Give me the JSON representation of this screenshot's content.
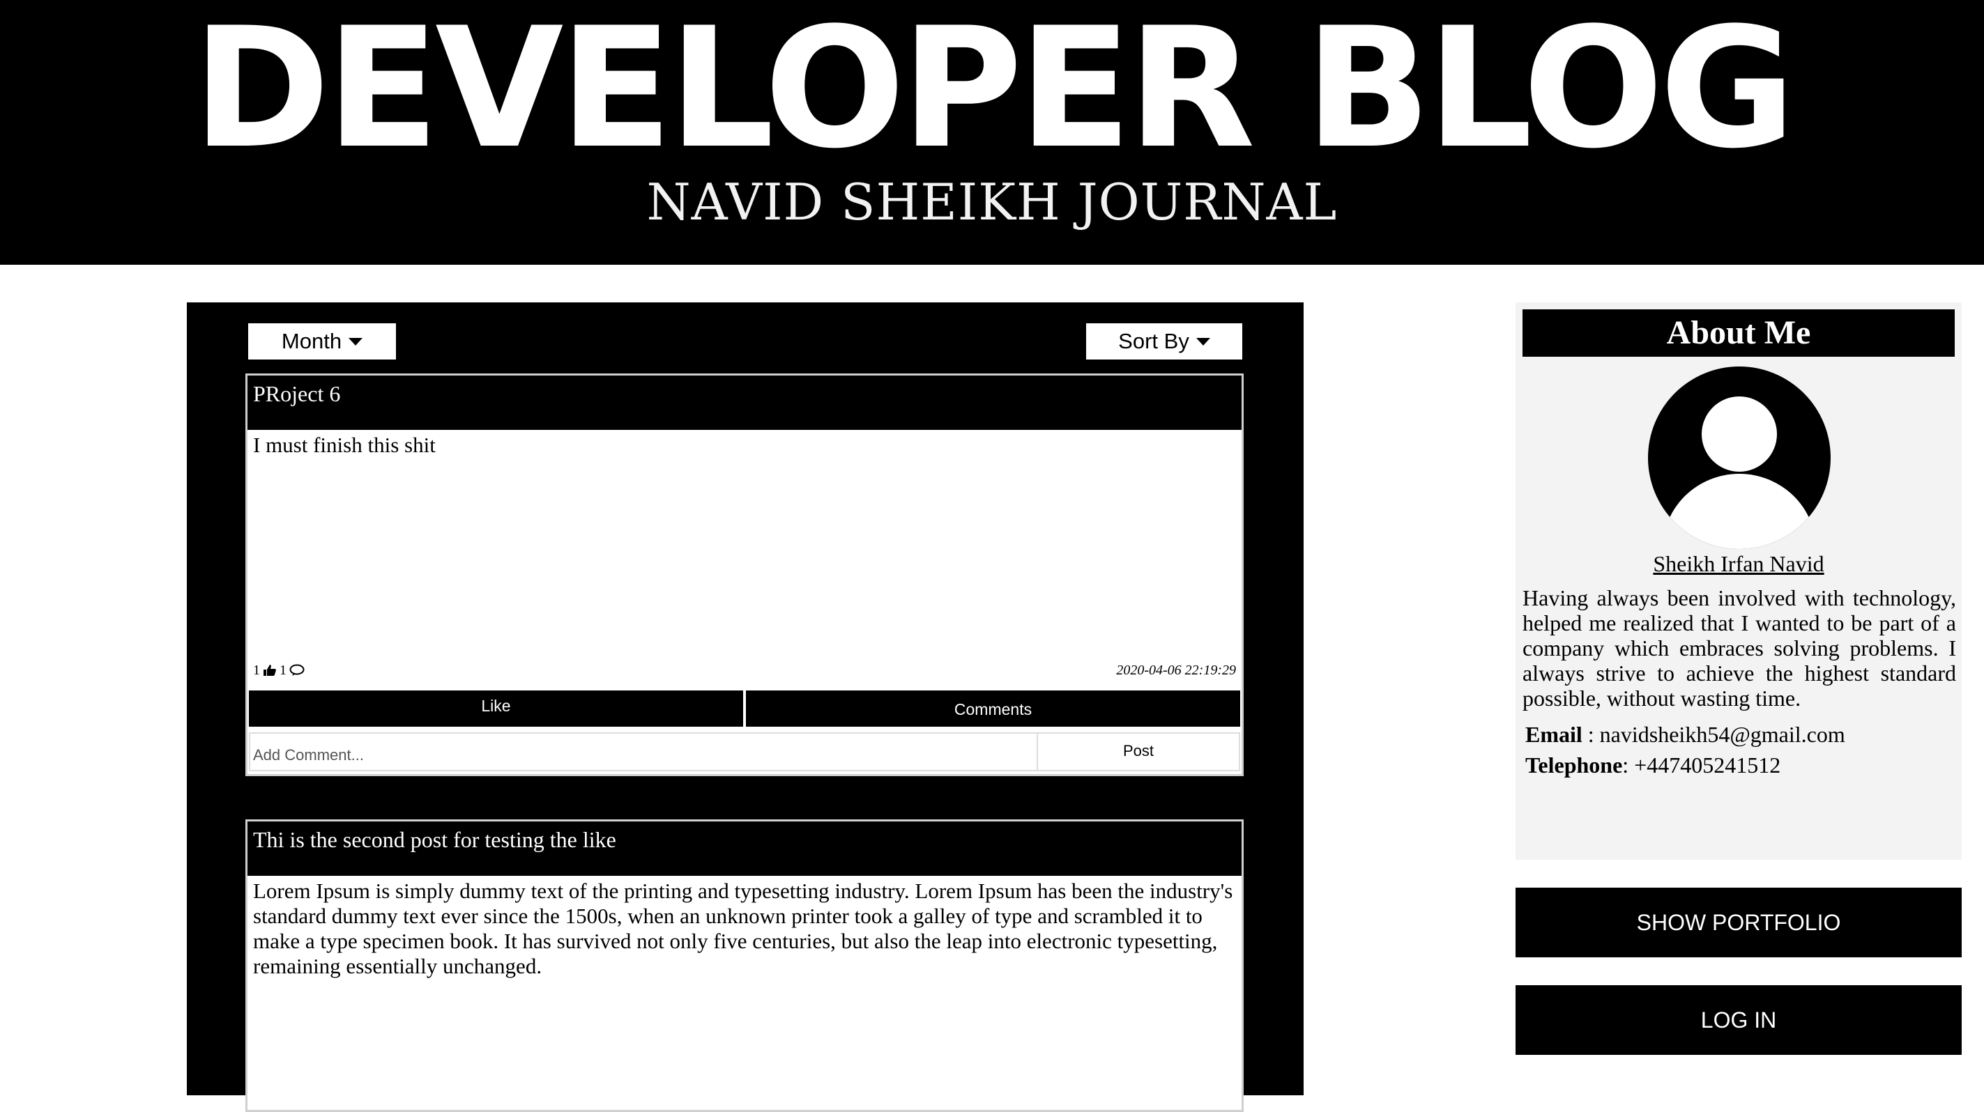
{
  "header": {
    "title": "DEVELOPER BLOG",
    "subtitle": "NAVID SHEIKH JOURNAL"
  },
  "filters": {
    "month_label": "Month",
    "sort_label": "Sort By"
  },
  "posts": [
    {
      "title": "PRoject 6",
      "body": "I must finish this shit",
      "likes": "1",
      "comments_count": "1",
      "date": "2020-04-06 22:19:29",
      "like_label": "Like",
      "comments_label": "Comments",
      "comment_placeholder": "Add Comment...",
      "post_label": "Post"
    },
    {
      "title": "Thi is the second post for testing the like",
      "body": "Lorem Ipsum is simply dummy text of the printing and typesetting industry. Lorem Ipsum has been the industry's standard dummy text ever since the 1500s, when an unknown printer took a galley of type and scrambled it to make a type specimen book. It has survived not only five centuries, but also the leap into electronic typesetting, remaining essentially unchanged."
    }
  ],
  "about": {
    "heading": "About Me",
    "name": "Sheikh Irfan Navid",
    "bio": "Having always been involved with technology, helped me realized that I wanted to be part of a company which embraces solving problems. I always strive to achieve the highest standard possible, without wasting time.",
    "email_label": "Email",
    "email_value": " : navidsheikh54@gmail.com",
    "telephone_label": "Telephone",
    "telephone_value": ": +447405241512"
  },
  "sidebar_buttons": {
    "portfolio": "SHOW PORTFOLIO",
    "login": "LOG IN"
  }
}
